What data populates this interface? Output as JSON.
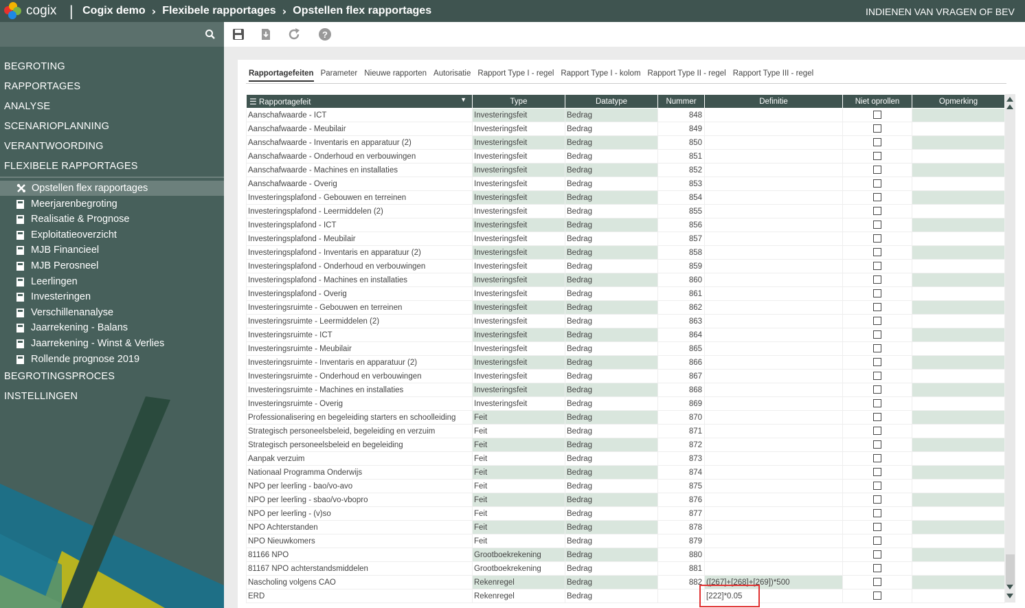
{
  "header": {
    "brand": "cogix",
    "separator": "|",
    "breadcrumb": [
      "Cogix demo",
      "Flexibele rapportages",
      "Opstellen flex rapportages"
    ],
    "crumb_sep": "›",
    "right_link": "INDIENEN VAN VRAGEN OF BEV"
  },
  "sidebar": {
    "main_top": [
      "BEGROTING",
      "RAPPORTAGES",
      "ANALYSE",
      "SCENARIOPLANNING",
      "VERANTWOORDING",
      "FLEXIBELE RAPPORTAGES"
    ],
    "active_label": "Opstellen flex rapportages",
    "sub_items": [
      "Meerjarenbegroting",
      "Realisatie & Prognose",
      "Exploitatieoverzicht",
      "MJB Financieel",
      "MJB Perosneel",
      "Leerlingen",
      "Investeringen",
      "Verschillenanalyse",
      "Jaarrekening - Balans",
      "Jaarrekening - Winst & Verlies",
      "Rollende prognose 2019"
    ],
    "main_bottom": [
      "BEGROTINGSPROCES",
      "INSTELLINGEN"
    ]
  },
  "toolbar": [
    "save-icon",
    "download-icon",
    "refresh-icon",
    "help-icon"
  ],
  "tabs": [
    "Rapportagefeiten",
    "Parameter",
    "Nieuwe rapporten",
    "Autorisatie",
    "Rapport Type I - regel",
    "Rapport Type I - kolom",
    "Rapport Type II - regel",
    "Rapport Type III - regel"
  ],
  "columns": [
    "Rapportagefeit",
    "Type",
    "Datatype",
    "Nummer",
    "Definitie",
    "Niet oprollen",
    "Opmerking"
  ],
  "rows": [
    {
      "feit": "Aanschafwaarde - ICT",
      "type": "Investeringsfeit",
      "datatype": "Bedrag",
      "nummer": "848",
      "definitie": ""
    },
    {
      "feit": "Aanschafwaarde - Meubilair",
      "type": "Investeringsfeit",
      "datatype": "Bedrag",
      "nummer": "849",
      "definitie": ""
    },
    {
      "feit": "Aanschafwaarde - Inventaris en apparatuur (2)",
      "type": "Investeringsfeit",
      "datatype": "Bedrag",
      "nummer": "850",
      "definitie": ""
    },
    {
      "feit": "Aanschafwaarde - Onderhoud en verbouwingen",
      "type": "Investeringsfeit",
      "datatype": "Bedrag",
      "nummer": "851",
      "definitie": ""
    },
    {
      "feit": "Aanschafwaarde - Machines en installaties",
      "type": "Investeringsfeit",
      "datatype": "Bedrag",
      "nummer": "852",
      "definitie": ""
    },
    {
      "feit": "Aanschafwaarde - Overig",
      "type": "Investeringsfeit",
      "datatype": "Bedrag",
      "nummer": "853",
      "definitie": ""
    },
    {
      "feit": "Investeringsplafond - Gebouwen en terreinen",
      "type": "Investeringsfeit",
      "datatype": "Bedrag",
      "nummer": "854",
      "definitie": ""
    },
    {
      "feit": "Investeringsplafond - Leermiddelen (2)",
      "type": "Investeringsfeit",
      "datatype": "Bedrag",
      "nummer": "855",
      "definitie": ""
    },
    {
      "feit": "Investeringsplafond - ICT",
      "type": "Investeringsfeit",
      "datatype": "Bedrag",
      "nummer": "856",
      "definitie": ""
    },
    {
      "feit": "Investeringsplafond - Meubilair",
      "type": "Investeringsfeit",
      "datatype": "Bedrag",
      "nummer": "857",
      "definitie": ""
    },
    {
      "feit": "Investeringsplafond - Inventaris en apparatuur (2)",
      "type": "Investeringsfeit",
      "datatype": "Bedrag",
      "nummer": "858",
      "definitie": ""
    },
    {
      "feit": "Investeringsplafond - Onderhoud en verbouwingen",
      "type": "Investeringsfeit",
      "datatype": "Bedrag",
      "nummer": "859",
      "definitie": ""
    },
    {
      "feit": "Investeringsplafond - Machines en installaties",
      "type": "Investeringsfeit",
      "datatype": "Bedrag",
      "nummer": "860",
      "definitie": ""
    },
    {
      "feit": "Investeringsplafond - Overig",
      "type": "Investeringsfeit",
      "datatype": "Bedrag",
      "nummer": "861",
      "definitie": ""
    },
    {
      "feit": "Investeringsruimte - Gebouwen en terreinen",
      "type": "Investeringsfeit",
      "datatype": "Bedrag",
      "nummer": "862",
      "definitie": ""
    },
    {
      "feit": "Investeringsruimte - Leermiddelen (2)",
      "type": "Investeringsfeit",
      "datatype": "Bedrag",
      "nummer": "863",
      "definitie": ""
    },
    {
      "feit": "Investeringsruimte - ICT",
      "type": "Investeringsfeit",
      "datatype": "Bedrag",
      "nummer": "864",
      "definitie": ""
    },
    {
      "feit": "Investeringsruimte - Meubilair",
      "type": "Investeringsfeit",
      "datatype": "Bedrag",
      "nummer": "865",
      "definitie": ""
    },
    {
      "feit": "Investeringsruimte - Inventaris en apparatuur (2)",
      "type": "Investeringsfeit",
      "datatype": "Bedrag",
      "nummer": "866",
      "definitie": ""
    },
    {
      "feit": "Investeringsruimte - Onderhoud en verbouwingen",
      "type": "Investeringsfeit",
      "datatype": "Bedrag",
      "nummer": "867",
      "definitie": ""
    },
    {
      "feit": "Investeringsruimte - Machines en installaties",
      "type": "Investeringsfeit",
      "datatype": "Bedrag",
      "nummer": "868",
      "definitie": ""
    },
    {
      "feit": "Investeringsruimte - Overig",
      "type": "Investeringsfeit",
      "datatype": "Bedrag",
      "nummer": "869",
      "definitie": ""
    },
    {
      "feit": "Professionalisering en begeleiding starters en schoolleiding",
      "type": "Feit",
      "datatype": "Bedrag",
      "nummer": "870",
      "definitie": ""
    },
    {
      "feit": "Strategisch personeelsbeleid, begeleiding en verzuim",
      "type": "Feit",
      "datatype": "Bedrag",
      "nummer": "871",
      "definitie": ""
    },
    {
      "feit": "Strategisch personeelsbeleid en begeleiding",
      "type": "Feit",
      "datatype": "Bedrag",
      "nummer": "872",
      "definitie": ""
    },
    {
      "feit": "Aanpak verzuim",
      "type": "Feit",
      "datatype": "Bedrag",
      "nummer": "873",
      "definitie": ""
    },
    {
      "feit": "Nationaal Programma Onderwijs",
      "type": "Feit",
      "datatype": "Bedrag",
      "nummer": "874",
      "definitie": ""
    },
    {
      "feit": "NPO per leerling - bao/vo-avo",
      "type": "Feit",
      "datatype": "Bedrag",
      "nummer": "875",
      "definitie": ""
    },
    {
      "feit": "NPO per leerling - sbao/vo-vbopro",
      "type": "Feit",
      "datatype": "Bedrag",
      "nummer": "876",
      "definitie": ""
    },
    {
      "feit": "NPO per leerling - (v)so",
      "type": "Feit",
      "datatype": "Bedrag",
      "nummer": "877",
      "definitie": ""
    },
    {
      "feit": "NPO Achterstanden",
      "type": "Feit",
      "datatype": "Bedrag",
      "nummer": "878",
      "definitie": ""
    },
    {
      "feit": "NPO Nieuwkomers",
      "type": "Feit",
      "datatype": "Bedrag",
      "nummer": "879",
      "definitie": ""
    },
    {
      "feit": "81166 NPO",
      "type": "Grootboekrekening",
      "datatype": "Bedrag",
      "nummer": "880",
      "definitie": ""
    },
    {
      "feit": "81167 NPO achterstandsmiddelen",
      "type": "Grootboekrekening",
      "datatype": "Bedrag",
      "nummer": "881",
      "definitie": ""
    },
    {
      "feit": "Nascholing volgens CAO",
      "type": "Rekenregel",
      "datatype": "Bedrag",
      "nummer": "882",
      "definitie": "([267]+[268]+[269])*500"
    },
    {
      "feit": "ERD",
      "type": "Rekenregel",
      "datatype": "Bedrag",
      "nummer": "",
      "definitie": "[222]*0.05"
    }
  ],
  "colors": {
    "header_bg": "#3f5450",
    "sidebar_bg": "#47605b",
    "row_green": "#d9e6dd",
    "highlight_box": "#e03030"
  }
}
